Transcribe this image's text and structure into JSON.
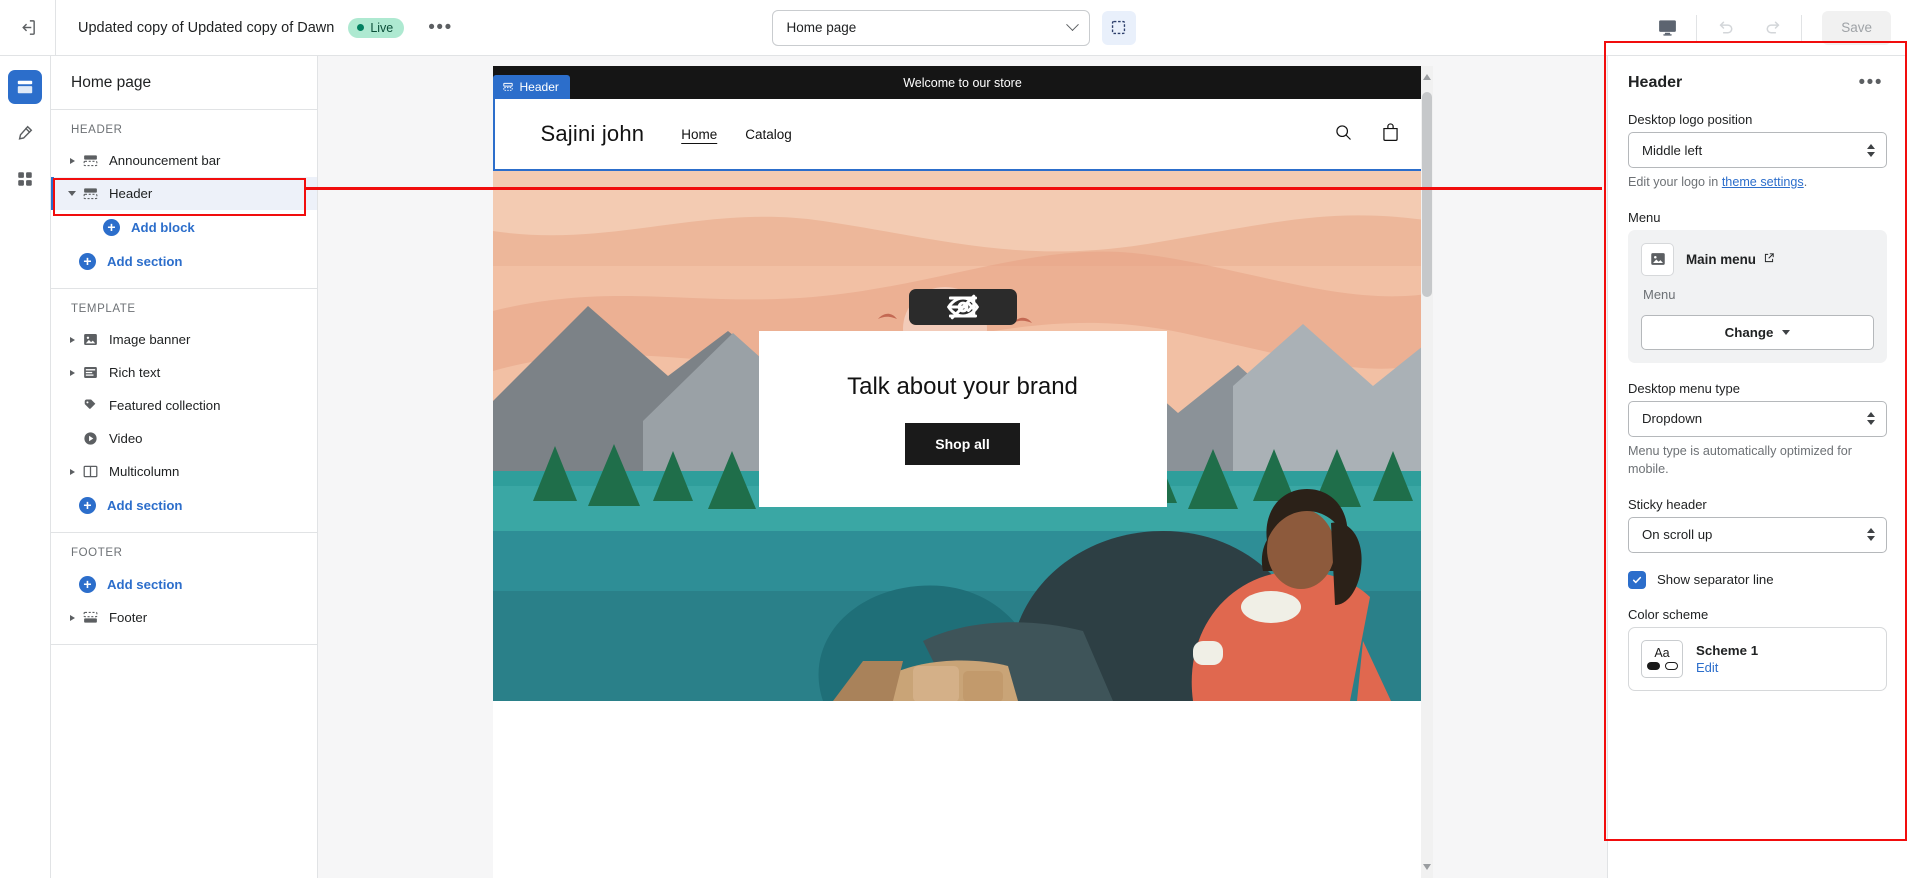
{
  "topbar": {
    "exit_icon": "exit-icon",
    "theme_name": "Updated copy of Updated copy of Dawn",
    "live_badge": "Live",
    "more_label": "•••",
    "page_selector_value": "Home page",
    "select_tool_icon": "select-region-icon",
    "device_icon": "desktop-icon",
    "undo_icon": "undo-icon",
    "redo_icon": "redo-icon",
    "save_label": "Save"
  },
  "rail": {
    "items": [
      {
        "name": "sections-icon",
        "active": true
      },
      {
        "name": "theme-settings-icon",
        "active": false
      },
      {
        "name": "apps-icon",
        "active": false
      }
    ]
  },
  "sidebar": {
    "title": "Home page",
    "groups": [
      {
        "label": "HEADER",
        "rows": [
          {
            "label": "Announcement bar",
            "icon": "announcement-bar-icon",
            "caret": "closed",
            "selected": false
          },
          {
            "label": "Header",
            "icon": "header-section-icon",
            "caret": "open",
            "selected": true
          }
        ],
        "adds": [
          {
            "label": "Add block",
            "indent": true
          },
          {
            "label": "Add section",
            "indent": false
          }
        ]
      },
      {
        "label": "TEMPLATE",
        "rows": [
          {
            "label": "Image banner",
            "icon": "image-banner-icon",
            "caret": "closed",
            "selected": false
          },
          {
            "label": "Rich text",
            "icon": "rich-text-icon",
            "caret": "closed",
            "selected": false
          },
          {
            "label": "Featured collection",
            "icon": "featured-collection-icon",
            "caret": "none",
            "selected": false
          },
          {
            "label": "Video",
            "icon": "video-icon",
            "caret": "none",
            "selected": false
          },
          {
            "label": "Multicolumn",
            "icon": "multicolumn-icon",
            "caret": "closed",
            "selected": false
          }
        ],
        "adds": [
          {
            "label": "Add section",
            "indent": false
          }
        ]
      },
      {
        "label": "FOOTER",
        "rows": [],
        "adds": [
          {
            "label": "Add section",
            "indent": false
          }
        ],
        "rows_after": [
          {
            "label": "Footer",
            "icon": "footer-section-icon",
            "caret": "closed",
            "selected": false
          }
        ]
      }
    ]
  },
  "preview": {
    "section_tag": "Header",
    "announcement": "Welcome to our store",
    "store_name": "Sajini john",
    "nav": [
      {
        "label": "Home",
        "active": true
      },
      {
        "label": "Catalog",
        "active": false
      }
    ],
    "search_icon": "search-icon",
    "cart_icon": "cart-icon",
    "hero_title": "Talk about your brand",
    "hero_button": "Shop all",
    "float_tools": [
      "move-up-icon",
      "move-down-icon",
      "hide-icon"
    ]
  },
  "settings": {
    "title": "Header",
    "more_label": "•••",
    "logo_position_label": "Desktop logo position",
    "logo_position_value": "Middle left",
    "logo_help_prefix": "Edit your logo in ",
    "logo_help_link": "theme settings",
    "logo_help_suffix": ".",
    "menu_label": "Menu",
    "menu_card": {
      "name": "Main menu",
      "external_icon": "external-link-icon",
      "thumb_icon": "image-placeholder-icon",
      "subtitle": "Menu",
      "change_label": "Change"
    },
    "menu_type_label": "Desktop menu type",
    "menu_type_value": "Dropdown",
    "menu_type_help": "Menu type is automatically optimized for mobile.",
    "sticky_label": "Sticky header",
    "sticky_value": "On scroll up",
    "separator_label": "Show separator line",
    "separator_checked": true,
    "color_scheme_label": "Color scheme",
    "color_scheme_name": "Scheme 1",
    "color_scheme_edit": "Edit",
    "swatch_text": "Aa"
  },
  "colors": {
    "accent": "#2c6ecb",
    "annotation": "#f10d0d",
    "live_badge_bg": "#aee9d1",
    "dark": "#151515"
  }
}
